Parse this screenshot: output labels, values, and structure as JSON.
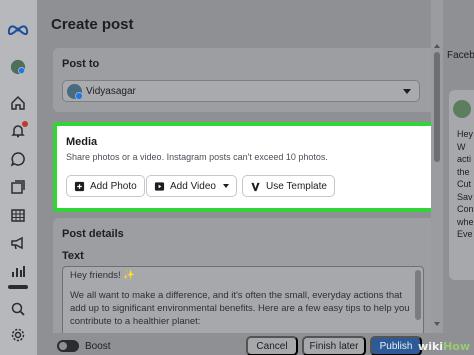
{
  "header": {
    "title": "Create post"
  },
  "post_to": {
    "label": "Post to",
    "selected_account": "Vidyasagar"
  },
  "media": {
    "heading": "Media",
    "subtitle": "Share photos or a video. Instagram posts can't exceed 10 photos.",
    "add_photo_label": "Add Photo",
    "add_video_label": "Add Video",
    "use_template_label": "Use Template",
    "highlight_color": "#33d43a"
  },
  "post_details": {
    "heading": "Post details",
    "text_label": "Text",
    "text_lines": [
      "Hey friends! ✨",
      "We all want to make a difference, and it's often the small, everyday actions that add up to significant environmental benefits. Here are a few easy tips to help you contribute to a healthier planet:"
    ]
  },
  "preview": {
    "title": "Faceb",
    "lines": [
      "Hey",
      "W",
      "acti",
      "the",
      "Cut",
      "Sav",
      "Con",
      "whe",
      "Eve"
    ]
  },
  "footer": {
    "boost_label": "Boost",
    "cancel_label": "Cancel",
    "finish_later_label": "Finish later",
    "publish_label": "Publish"
  },
  "watermark": {
    "prefix": "wiki",
    "suffix": "How"
  },
  "nav_icons": [
    "meta-logo-icon",
    "profile-avatar-icon",
    "home-icon",
    "notifications-icon",
    "messages-icon",
    "content-icon",
    "calendar-icon",
    "ads-icon",
    "insights-icon",
    "menu-icon",
    "search-icon",
    "settings-icon"
  ]
}
